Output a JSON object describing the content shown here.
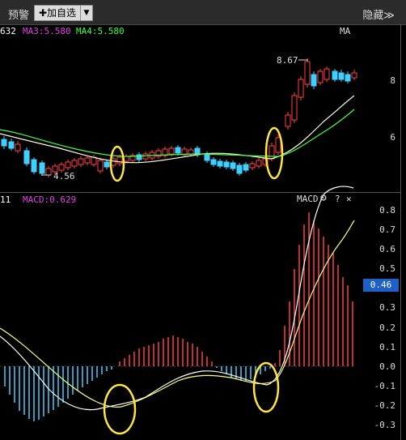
{
  "toolbar": {
    "alert_label": "预警",
    "add_label": "✚加自选",
    "dropdown_icon": "▼",
    "hide_label": "隐藏≫"
  },
  "ma_panel": {
    "legend": [
      {
        "text": "632",
        "color": "#ffffff"
      },
      {
        "text": "MA3:5.580",
        "color": "#e040e0"
      },
      {
        "text": "MA4:5.580",
        "color": "#40ff40"
      }
    ],
    "corner_label": "MA",
    "price_high_label": "8.67",
    "price_low_label": "4.56",
    "axis_ticks": [
      "8",
      "6"
    ]
  },
  "macd_panel": {
    "legend": [
      {
        "text": "11",
        "color": "#ffffff"
      },
      {
        "text": "MACD:0.629",
        "color": "#e040e0"
      }
    ],
    "title": "MACD",
    "gear_icon": "⚙",
    "help_icon": "?",
    "close_icon": "✕",
    "axis_ticks": [
      "0.8",
      "0.7",
      "0.6",
      "0.5",
      "0.4",
      "0.3",
      "0.2",
      "0.1",
      "0.0",
      "-0.1",
      "-0.2",
      "-0.3"
    ],
    "highlight_value": "0.46"
  },
  "colors": {
    "up": "#ff4040",
    "down": "#40d0ff",
    "ma_fast": "#ffffe0",
    "ma_slow": "#40ff40",
    "highlight": "#1f5fc8",
    "circle": "#ffe640"
  }
}
